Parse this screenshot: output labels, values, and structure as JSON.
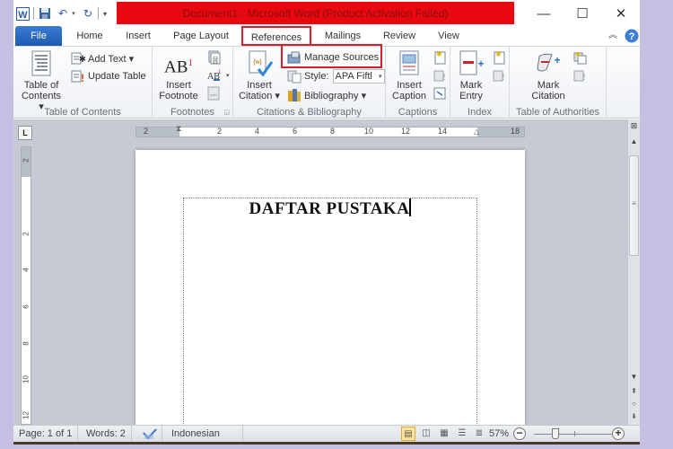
{
  "title_bar": {
    "title": "Document1  -  Microsoft Word (Product Activation Failed)",
    "title_bg": "#e8080f",
    "quick_access": [
      "word-logo-icon",
      "save-icon",
      "undo-icon",
      "redo-icon",
      "customize-icon"
    ],
    "window_controls": {
      "minimize": "—",
      "maximize": "☐",
      "close": "✕"
    }
  },
  "tabs": {
    "file": "File",
    "items": [
      "Home",
      "Insert",
      "Page Layout",
      "References",
      "Mailings",
      "Review",
      "View"
    ],
    "active": "References",
    "highlight_color": "#d3202a"
  },
  "ribbon": {
    "groups": [
      {
        "label": "Table of Contents",
        "large": {
          "label_line1": "Table of",
          "label_line2": "Contents ▾"
        },
        "small": [
          "Add Text ▾",
          "Update Table"
        ]
      },
      {
        "label": "Footnotes",
        "large": {
          "label_line1": "Insert",
          "label_line2": "Footnote",
          "glyph": "AB",
          "sup": "1"
        }
      },
      {
        "label": "Citations & Bibliography",
        "large": {
          "label_line1": "Insert",
          "label_line2": "Citation ▾"
        },
        "manage_sources": "Manage Sources",
        "style_label": "Style:",
        "style_value": "APA Fiftl",
        "bibliography": "Bibliography ▾"
      },
      {
        "label": "Captions",
        "large": {
          "label_line1": "Insert",
          "label_line2": "Caption"
        }
      },
      {
        "label": "Index",
        "large": {
          "label_line1": "Mark",
          "label_line2": "Entry"
        }
      },
      {
        "label": "Table of Authorities",
        "large": {
          "label_line1": "Mark",
          "label_line2": "Citation"
        }
      }
    ]
  },
  "ruler": {
    "horizontal_ticks": [
      "2",
      "2",
      "4",
      "6",
      "8",
      "10",
      "12",
      "14",
      "18"
    ],
    "vertical_ticks": [
      "2",
      "2",
      "4",
      "6",
      "8",
      "10",
      "12"
    ]
  },
  "document": {
    "heading": "DAFTAR PUSTAKA"
  },
  "status_bar": {
    "page": "Page: 1 of 1",
    "words": "Words: 2",
    "language": "Indonesian",
    "zoom": "57%",
    "zoom_fraction": 0.57
  }
}
